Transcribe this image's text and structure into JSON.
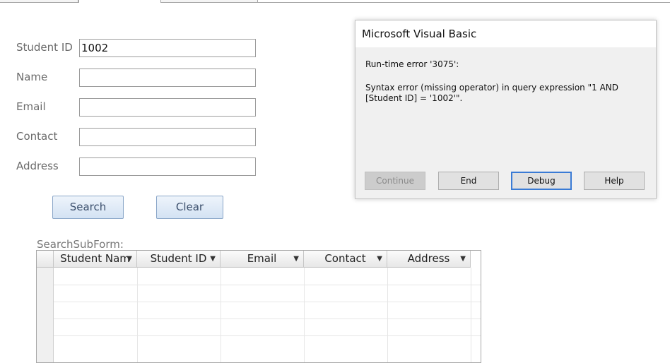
{
  "form": {
    "fields": [
      {
        "label": "Student ID",
        "value": "1002"
      },
      {
        "label": "Name",
        "value": ""
      },
      {
        "label": "Email",
        "value": ""
      },
      {
        "label": "Contact",
        "value": ""
      },
      {
        "label": "Address",
        "value": ""
      }
    ],
    "search_label": "Search",
    "clear_label": "Clear"
  },
  "subform": {
    "label": "SearchSubForm:",
    "columns": [
      "Student Nam",
      "Student ID",
      "Email",
      "Contact",
      "Address"
    ],
    "dropdown_icon": "chevron-down-icon"
  },
  "dialog": {
    "title": "Microsoft Visual Basic",
    "error_line": "Run-time error '3075':",
    "message": "Syntax error (missing operator) in query expression \"1  AND [Student ID] = '1002'\".",
    "buttons": {
      "continue": "Continue",
      "end": "End",
      "debug": "Debug",
      "help": "Help"
    }
  }
}
